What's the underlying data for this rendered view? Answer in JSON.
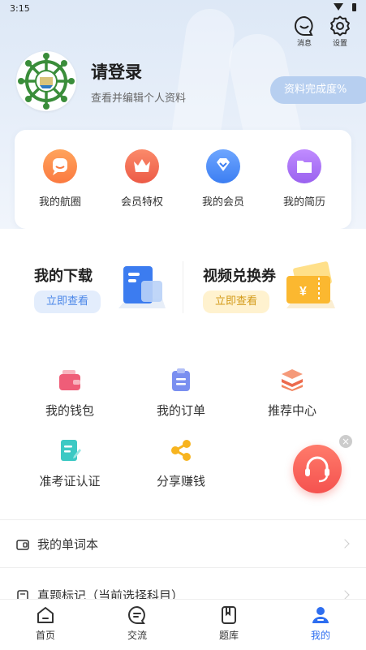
{
  "status_bar": {
    "time": "3:15"
  },
  "header": {
    "messages_label": "消息",
    "settings_label": "设置",
    "login_title": "请登录",
    "login_subtitle": "查看并编辑个人资料",
    "profile_completion": "资料完成度%"
  },
  "quick_actions": [
    {
      "label": "我的航圈",
      "icon": "chat-bubble-icon",
      "color": "#fd8a4c"
    },
    {
      "label": "会员特权",
      "icon": "crown-icon",
      "color": "#f26a54"
    },
    {
      "label": "我的会员",
      "icon": "diamond-icon",
      "color": "#4c8cf5"
    },
    {
      "label": "我的简历",
      "icon": "folder-icon",
      "color": "#a36ef2"
    }
  ],
  "promos": {
    "downloads": {
      "title": "我的下载",
      "button": "立即查看"
    },
    "voucher": {
      "title": "视频兑换券",
      "button": "立即查看",
      "symbol": "¥"
    }
  },
  "grid": [
    {
      "label": "我的钱包",
      "icon": "wallet-icon"
    },
    {
      "label": "我的订单",
      "icon": "clipboard-icon"
    },
    {
      "label": "推荐中心",
      "icon": "stack-icon"
    },
    {
      "label": "准考证认证",
      "icon": "document-edit-icon"
    },
    {
      "label": "分享赚钱",
      "icon": "share-icon"
    }
  ],
  "list": [
    {
      "label": "我的单词本"
    },
    {
      "label": "真题标记（当前选择科目）"
    }
  ],
  "service": {
    "close_symbol": "×"
  },
  "tabs": [
    {
      "label": "首页",
      "active": false
    },
    {
      "label": "交流",
      "active": false
    },
    {
      "label": "题库",
      "active": false
    },
    {
      "label": "我的",
      "active": true
    }
  ],
  "colors": {
    "accent": "#2e6ef0",
    "completion_bg": "#b7cff0"
  }
}
